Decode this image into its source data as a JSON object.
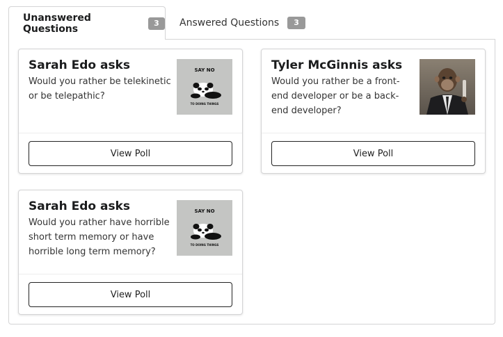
{
  "tabs": [
    {
      "label": "Unanswered Questions",
      "count": "3",
      "active": true
    },
    {
      "label": "Answered Questions",
      "count": "3",
      "active": false
    }
  ],
  "cards": [
    {
      "title": "Sarah Edo asks",
      "question": "Would you rather be telekinetic or be telepathic?",
      "avatar": "say-no-panda",
      "button": "View Poll"
    },
    {
      "title": "Tyler McGinnis asks",
      "question": "Would you rather be a front-end developer or be a back-end developer?",
      "avatar": "suited-monkey",
      "button": "View Poll"
    },
    {
      "title": "Sarah Edo asks",
      "question": "Would you rather have horrible short term memory or have horrible long term memory?",
      "avatar": "say-no-panda",
      "button": "View Poll"
    }
  ],
  "avatar_text": {
    "say_no": "SAY NO",
    "to_doing_things": "TO DOING THINGS"
  }
}
